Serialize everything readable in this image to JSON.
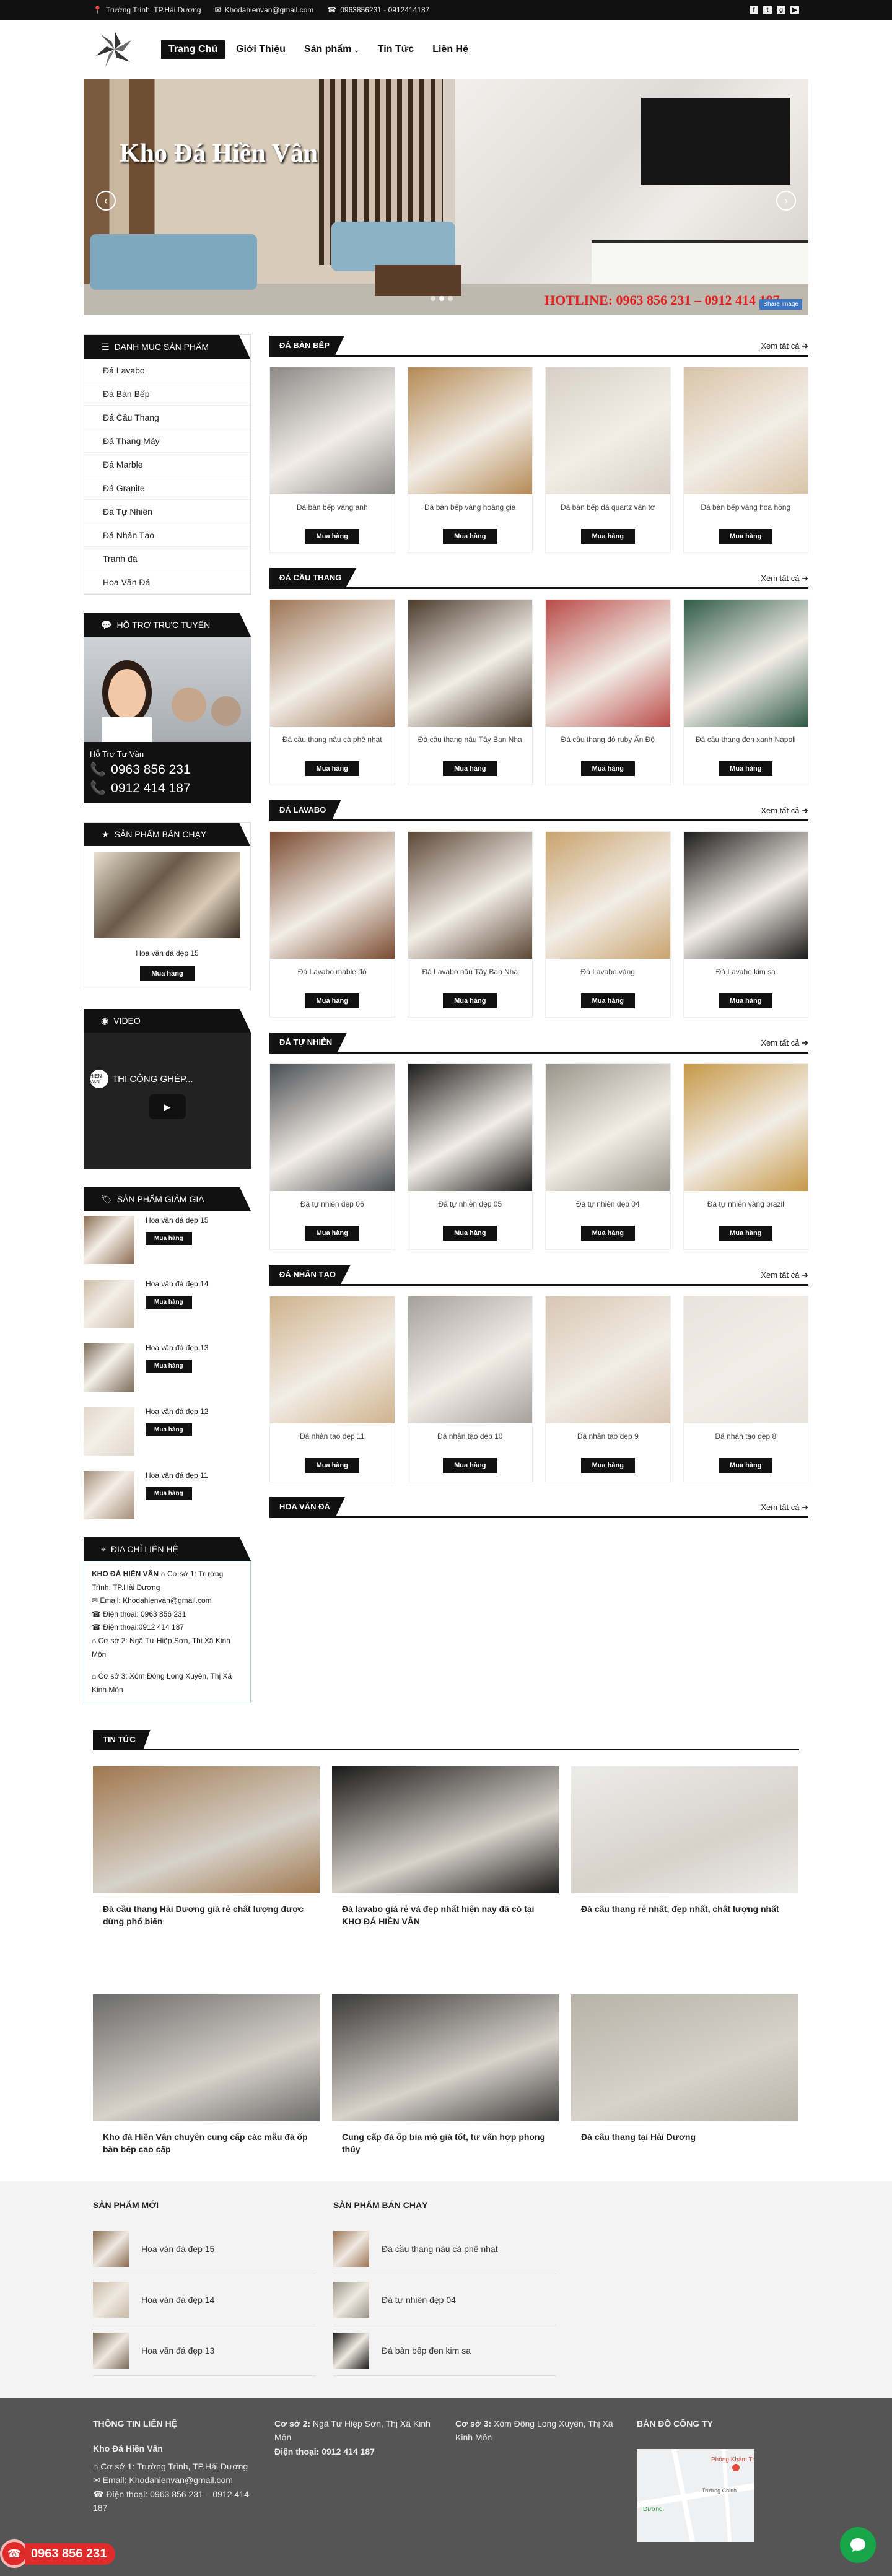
{
  "topbar": {
    "address": "Trường Trình, TP.Hải Dương",
    "email": "Khodahienvan@gmail.com",
    "phone": "0963856231 - 0912414187",
    "social": [
      "f",
      "t",
      "g",
      "▶"
    ]
  },
  "nav": {
    "items": [
      "Trang Chủ",
      "Giới Thiệu",
      "Sản phẩm",
      "Tin Tức",
      "Liên Hệ"
    ],
    "dropdown_icon": "chevron-down-icon"
  },
  "banner": {
    "title": "Kho Đá Hiền Vân",
    "hotline": "HOTLINE: 0963 856 231  –  0912 414 187",
    "share": "Share image",
    "prev": "‹",
    "next": "›"
  },
  "sidebar": {
    "categories_title": "DANH MỤC SẢN PHẨM",
    "categories": [
      "Đá Lavabo",
      "Đá Bàn Bếp",
      "Đá Cầu Thang",
      "Đá Thang Máy",
      "Đá Marble",
      "Đá Granite",
      "Đá Tự Nhiên",
      "Đá Nhân Tạo",
      "Tranh đá",
      "Hoa Văn Đá"
    ],
    "support_title": "HỖ TRỢ TRỰC TUYẾN",
    "support_label": "Hỗ Trợ Tư Vấn",
    "support_phones": [
      "0963 856 231",
      "0912 414 187"
    ],
    "bestseller_title": "SẢN PHẨM BÁN CHẠY",
    "bestseller_item": "Hoa văn đá đẹp 15",
    "buy": "Mua hàng",
    "video_title": "VIDEO",
    "video_caption": "THI CÔNG GHÉP...",
    "video_logo": "HIEN VAN",
    "sale_title": "SẢN PHẨM GIẢM GIÁ",
    "sale_items": [
      "Hoa văn đá đẹp 15",
      "Hoa văn đá đẹp 14",
      "Hoa văn đá đẹp 13",
      "Hoa văn đá đẹp 12",
      "Hoa văn đá đẹp 11"
    ],
    "contact_title": "ĐỊA CHỈ LIÊN HỆ",
    "contact_company": "KHO ĐÁ HIỀN VÂN",
    "contact_line1": "Cơ sở 1: Trường Trình, TP.Hải Dương",
    "contact_email": "Email: Khodahienvan@gmail.com",
    "contact_phone1": "Điện thoại: 0963 856 231",
    "contact_phone2": "Điện thoại:0912 414 187",
    "contact_line2": "Cơ sở 2: Ngã Tư Hiệp Sơn, Thị Xã Kinh Môn",
    "contact_line3": "Cơ sở 3: Xóm Đông Long Xuyên, Thị Xã Kinh Môn"
  },
  "sections": [
    {
      "title": "ĐÁ BÀN BẾP",
      "all": "Xem tất cả",
      "products": [
        "Đá bàn bếp vàng anh",
        "Đá bàn bếp vàng hoàng gia",
        "Đá bàn bếp đá quartz vân tơ",
        "Đá bàn bếp vàng hoa hồng"
      ],
      "colors": [
        "#8b8a88",
        "#b58a55",
        "#d8d0c6",
        "#d9c4a8"
      ]
    },
    {
      "title": "ĐÁ CẦU THANG",
      "all": "Xem tất cả",
      "products": [
        "Đá cầu thang nâu cà phê nhạt",
        "Đá cầu thang nâu Tây Ban Nha",
        "Đá cầu thang đỏ ruby Ấn Độ",
        "Đá cầu thang đen xanh Napoli"
      ],
      "colors": [
        "#9c7454",
        "#4a3a2c",
        "#b94a48",
        "#2f5a49"
      ]
    },
    {
      "title": "ĐÁ LAVABO",
      "all": "Xem tất cả",
      "products": [
        "Đá Lavabo mable đỏ",
        "Đá Lavabo nâu Tây Ban Nha",
        "Đá Lavabo vàng",
        "Đá Lavabo kim sa"
      ],
      "colors": [
        "#7a4a30",
        "#5b4636",
        "#c9a36e",
        "#1b1b1b"
      ]
    },
    {
      "title": "ĐÁ TỰ NHIÊN",
      "all": "Xem tất cả",
      "products": [
        "Đá tự nhiên đẹp 06",
        "Đá tự nhiên đẹp 05",
        "Đá tự nhiên đẹp 04",
        "Đá tự nhiên vàng brazil"
      ],
      "colors": [
        "#4a4d52",
        "#1c1c1c",
        "#9a948a",
        "#c69847"
      ]
    },
    {
      "title": "ĐÁ NHÂN TẠO",
      "all": "Xem tất cả",
      "products": [
        "Đá nhân tạo đẹp 11",
        "Đá nhân tạo đẹp 10",
        "Đá nhân tạo đẹp 9",
        "Đá nhân tạo đẹp 8"
      ],
      "colors": [
        "#cfb28c",
        "#a6a09a",
        "#d8c6b3",
        "#e8e3dc"
      ]
    },
    {
      "title": "HOA VĂN ĐÁ",
      "all": "Xem tất cả",
      "products": [],
      "colors": []
    }
  ],
  "news": {
    "title": "TIN TỨC",
    "items": [
      "Đá cầu thang Hải Dương giá rẻ chất lượng được dùng phổ biến",
      "Đá lavabo giá rẻ và đẹp nhất hiện nay đã có tại KHO ĐÁ HIỀN VÂN",
      "Đá cầu thang rẻ nhất, đẹp nhất, chất lượng nhất",
      "Kho đá Hiền Vân chuyên cung cấp các mẫu đá ốp bàn bếp cao cấp",
      "Cung cấp đá ốp bia mộ giá tốt, tư vấn hợp phong thủy",
      "Đá cầu thang tại Hải Dương"
    ],
    "colors": [
      "#a0784f",
      "#1a1a1a",
      "#ececea",
      "#6b6b6b",
      "#3a3a3a",
      "#b8b2a8"
    ]
  },
  "product_lists": {
    "new_title": "SẢN PHẨM MỚI",
    "new_items": [
      "Hoa văn đá đẹp 15",
      "Hoa văn đá đẹp 14",
      "Hoa văn đá đẹp 13"
    ],
    "best_title": "SẢN PHẨM BÁN CHẠY",
    "best_items": [
      "Đá cầu thang nâu cà phê nhạt",
      "Đá tự nhiên đẹp 04",
      "Đá bàn bếp đen kim sa"
    ]
  },
  "footer": {
    "info_title": "THÔNG TIN LIÊN HỆ",
    "company": "Kho Đá Hiền Vân",
    "addr1": "Cơ sở 1: Trường Trình, TP.Hải Dương",
    "email": "Email: Khodahienvan@gmail.com",
    "phone": "Điện thoại: 0963 856 231 – 0912 414 187",
    "addr2_label": "Cơ sở 2:",
    "addr2": "Ngã Tư Hiệp Sơn, Thị Xã Kinh Môn",
    "phone2": "Điện thoại: 0912 414 187",
    "addr3_label": "Cơ sở 3:",
    "addr3": "Xóm Đông Long Xuyên, Thị Xã Kinh Môn",
    "map_title": "BẢN ĐỒ CÔNG TY",
    "map_label": "Phòng Khám Thanh Bình Hải",
    "map_street": "Trường Chinh",
    "map_place": "Dương"
  },
  "floating": {
    "hotline": "0963 856 231"
  }
}
